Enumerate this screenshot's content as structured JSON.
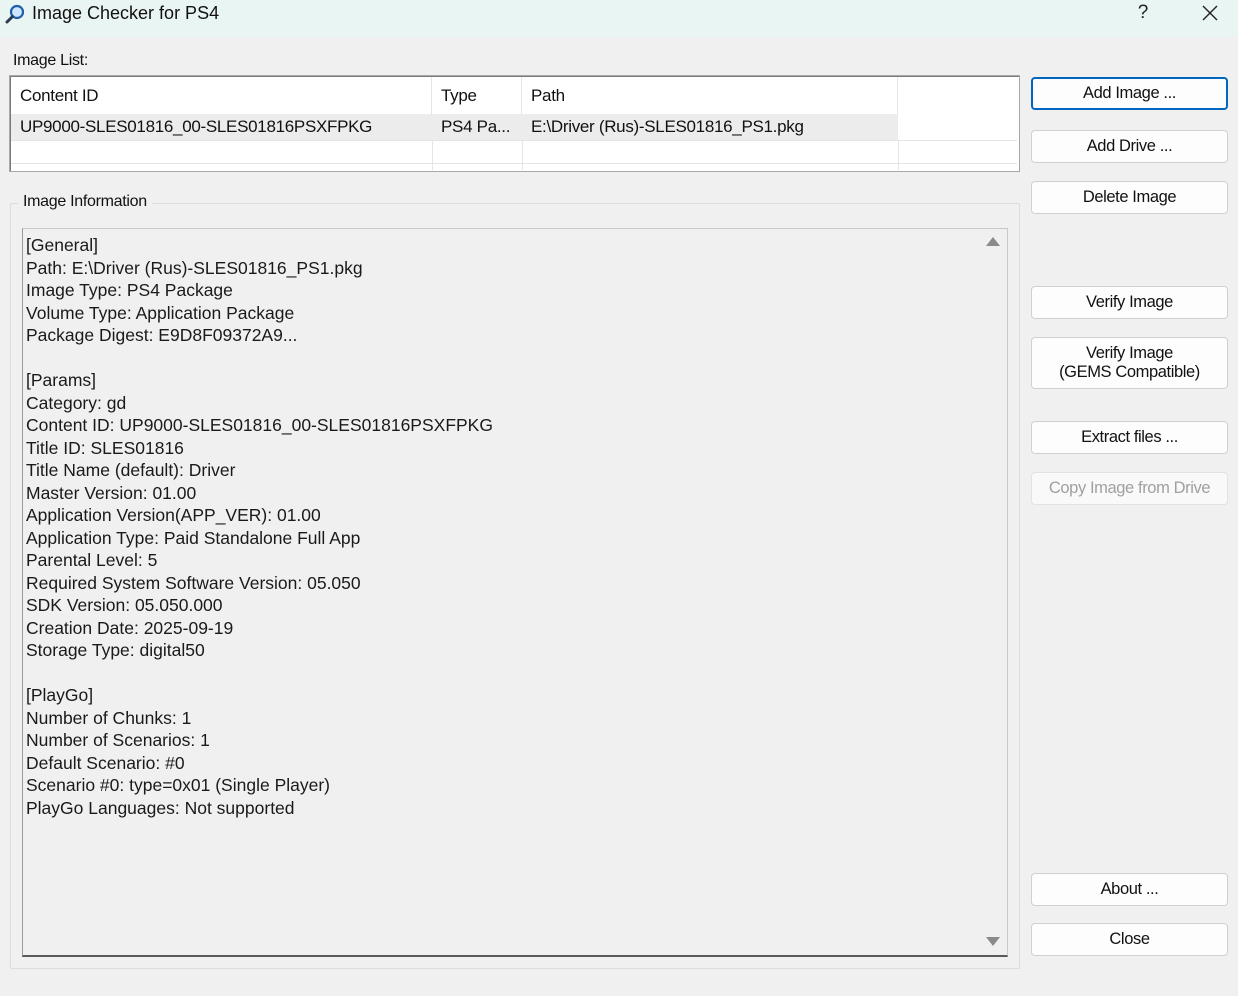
{
  "window": {
    "title": "Image Checker for PS4",
    "help_glyph": "?"
  },
  "image_list": {
    "label": "Image List:",
    "columns": [
      "Content ID",
      "Type",
      "Path"
    ],
    "rows": [
      {
        "content_id": "UP9000-SLES01816_00-SLES01816PSXFPKG",
        "type": "PS4 Pa...",
        "path": "E:\\Driver (Rus)-SLES01816_PS1.pkg"
      }
    ]
  },
  "image_information": {
    "label": "Image Information",
    "text": "[General]\nPath: E:\\Driver (Rus)-SLES01816_PS1.pkg\nImage Type: PS4 Package\nVolume Type: Application Package\nPackage Digest: E9D8F09372A9...\n\n[Params]\nCategory: gd\nContent ID: UP9000-SLES01816_00-SLES01816PSXFPKG\nTitle ID: SLES01816\nTitle Name (default): Driver\nMaster Version: 01.00\nApplication Version(APP_VER): 01.00\nApplication Type: Paid Standalone Full App\nParental Level: 5\nRequired System Software Version: 05.050\nSDK Version: 05.050.000\nCreation Date: 2025-09-19\nStorage Type: digital50\n\n[PlayGo]\nNumber of Chunks: 1\nNumber of Scenarios: 1\nDefault Scenario: #0\nScenario #0: type=0x01 (Single Player)\nPlayGo Languages: Not supported"
  },
  "buttons": {
    "add_image": "Add Image ...",
    "add_drive": "Add Drive ...",
    "delete_image": "Delete Image",
    "verify_image": "Verify Image",
    "verify_image_gems": "Verify Image\n(GEMS Compatible)",
    "extract_files": "Extract files ...",
    "copy_image_from_drive": "Copy Image from Drive",
    "about": "About ...",
    "close": "Close"
  },
  "colors": {
    "titlebar_bg": "#e9f5f2",
    "window_bg": "#f0f0f0",
    "accent": "#0067c0"
  },
  "icons": {
    "app": "magnifier-icon",
    "close": "close-icon",
    "scroll_up": "scroll-up-arrow-icon",
    "scroll_down": "scroll-down-arrow-icon"
  }
}
